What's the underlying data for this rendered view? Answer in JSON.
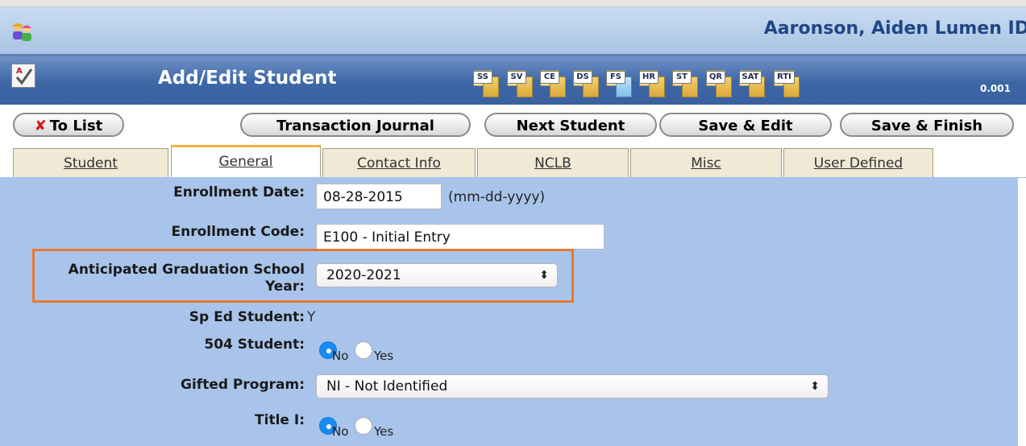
{
  "header": {
    "student_name": "Aaronson, Aiden Lumen ID",
    "page_title": "Add/Edit Student",
    "version": "0.001",
    "folders": [
      {
        "label": "SS",
        "icon": "folder-icon",
        "color": "#e9b84a"
      },
      {
        "label": "SV",
        "icon": "folder-icon",
        "color": "#e9b84a"
      },
      {
        "label": "CE",
        "icon": "folder-icon",
        "color": "#e9b84a"
      },
      {
        "label": "DS",
        "icon": "folder-icon",
        "color": "#e9b84a"
      },
      {
        "label": "FS",
        "icon": "folder-icon",
        "color": "#8fc8ec"
      },
      {
        "label": "HR",
        "icon": "folder-icon",
        "color": "#e9b84a"
      },
      {
        "label": "ST",
        "icon": "folder-icon",
        "color": "#e9b84a"
      },
      {
        "label": "QR",
        "icon": "folder-icon",
        "color": "#e9b84a"
      },
      {
        "label": "SAT",
        "icon": "folder-icon",
        "color": "#e9b84a"
      },
      {
        "label": "RTI",
        "icon": "folder-icon",
        "color": "#e9b84a"
      }
    ]
  },
  "buttons": {
    "to_list": "To List",
    "transaction_journal": "Transaction Journal",
    "next_student": "Next Student",
    "save_edit": "Save & Edit",
    "save_finish": "Save & Finish"
  },
  "tabs": [
    {
      "label": "Student",
      "active": false
    },
    {
      "label": "General",
      "active": true
    },
    {
      "label": "Contact Info",
      "active": false
    },
    {
      "label": "NCLB",
      "active": false
    },
    {
      "label": "Misc",
      "active": false
    },
    {
      "label": "User Defined",
      "active": false
    }
  ],
  "form": {
    "enrollment_date": {
      "label": "Enrollment Date:",
      "value": "08-28-2015",
      "hint": "(mm-dd-yyyy)"
    },
    "enrollment_code": {
      "label": "Enrollment Code:",
      "value": "E100 - Initial Entry"
    },
    "anticipated_grad": {
      "label_line1": "Anticipated Graduation School",
      "label_line2": "Year:",
      "value": "2020-2021"
    },
    "sp_ed": {
      "label": "Sp Ed Student:",
      "value": "Y"
    },
    "student_504": {
      "label": "504 Student:",
      "selected": "No",
      "options": [
        "No",
        "Yes"
      ]
    },
    "gifted": {
      "label": "Gifted Program:",
      "value": "NI - Not Identified"
    },
    "title_i": {
      "label": "Title I:",
      "selected": "No",
      "options": [
        "No",
        "Yes"
      ]
    }
  },
  "colors": {
    "highlight": "#e67a2e",
    "form_bg": "#a9c4ea",
    "header_blue": "#3d66a6",
    "radio_selected": "#1b8bf2"
  }
}
